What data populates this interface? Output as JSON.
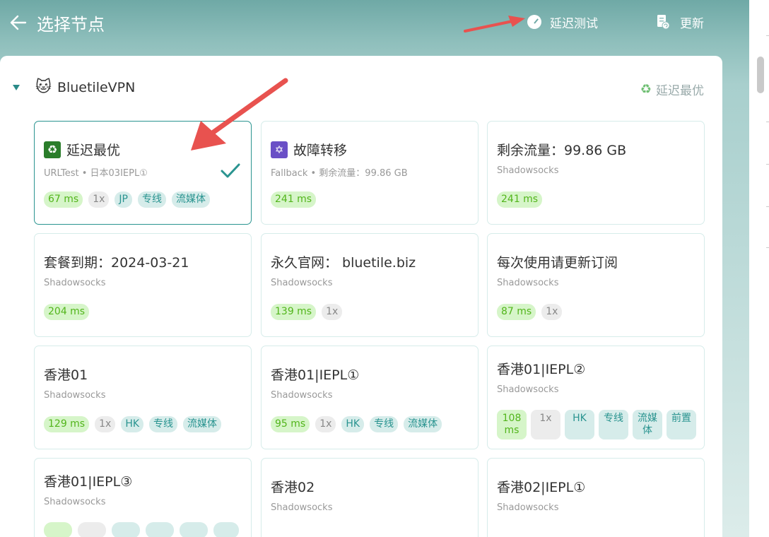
{
  "header": {
    "title": "选择节点",
    "delay_test_label": "延迟测试",
    "update_label": "更新"
  },
  "group": {
    "name": "BluetileVPN",
    "selected_label": "延迟最优"
  },
  "cards": [
    {
      "name": "延迟最优",
      "sub": "URLTest • 日本03IEPL①",
      "tags": [
        "67 ms",
        "1x",
        "JP",
        "专线",
        "流媒体"
      ]
    },
    {
      "name": "故障转移",
      "sub": "Fallback • 剩余流量：99.86 GB",
      "tags": [
        "241 ms"
      ]
    },
    {
      "name": "剩余流量：99.86 GB",
      "sub": "Shadowsocks",
      "tags": [
        "241 ms"
      ]
    },
    {
      "name": "套餐到期：2024-03-21",
      "sub": "Shadowsocks",
      "tags": [
        "204 ms"
      ]
    },
    {
      "name": "永久官网： bluetile.biz",
      "sub": "Shadowsocks",
      "tags": [
        "139 ms",
        "1x"
      ]
    },
    {
      "name": "每次使用请更新订阅",
      "sub": "Shadowsocks",
      "tags": [
        "87 ms",
        "1x"
      ]
    },
    {
      "name": "香港01",
      "sub": "Shadowsocks",
      "tags": [
        "129 ms",
        "1x",
        "HK",
        "专线",
        "流媒体"
      ]
    },
    {
      "name": "香港01|IEPL①",
      "sub": "Shadowsocks",
      "tags": [
        "95 ms",
        "1x",
        "HK",
        "专线",
        "流媒体"
      ]
    },
    {
      "name": "香港01|IEPL②",
      "sub": "Shadowsocks",
      "tags": [
        "108 ms",
        "1x",
        "HK",
        "专线",
        "流媒体",
        "前置"
      ]
    },
    {
      "name": "香港01|IEPL③",
      "sub": "Shadowsocks",
      "tags": []
    },
    {
      "name": "香港02",
      "sub": "Shadowsocks",
      "tags": []
    },
    {
      "name": "香港02|IEPL①",
      "sub": "Shadowsocks",
      "tags": []
    }
  ],
  "colors": {
    "accent": "#2a9490",
    "ms_bg": "#d6f5c9",
    "ms_fg": "#52b51b",
    "annotation_arrow": "#e8524f"
  },
  "icons": {
    "back": "arrow-left-icon",
    "delay_test": "speedometer-icon",
    "update": "document-refresh-icon",
    "group": "cat-face-icon",
    "selected": "recycle-icon",
    "fallback": "star-of-david-icon",
    "check": "checkmark-icon"
  }
}
